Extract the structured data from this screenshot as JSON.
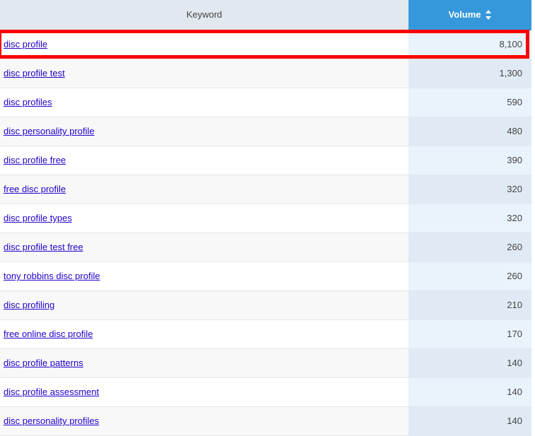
{
  "table": {
    "columns": [
      {
        "key": "keyword",
        "label": "Keyword",
        "align": "center",
        "sortable": false
      },
      {
        "key": "volume",
        "label": "Volume",
        "align": "center",
        "sortable": true,
        "sort_icon": "sort-updown-icon"
      }
    ],
    "header_accent_color": "#3498db",
    "header_keyword_bg": "#e2e8ef",
    "highlight_color": "#fa0000",
    "link_color": "#2200cc",
    "highlighted_row_index": 0,
    "rows": [
      {
        "keyword": "disc profile",
        "volume": "8,100"
      },
      {
        "keyword": "disc profile test",
        "volume": "1,300"
      },
      {
        "keyword": "disc profiles",
        "volume": "590"
      },
      {
        "keyword": "disc personality profile",
        "volume": "480"
      },
      {
        "keyword": "disc profile free",
        "volume": "390"
      },
      {
        "keyword": "free disc profile",
        "volume": "320"
      },
      {
        "keyword": "disc profile types",
        "volume": "320"
      },
      {
        "keyword": "disc profile test free",
        "volume": "260"
      },
      {
        "keyword": "tony robbins disc profile",
        "volume": "260"
      },
      {
        "keyword": "disc profiling",
        "volume": "210"
      },
      {
        "keyword": "free online disc profile",
        "volume": "170"
      },
      {
        "keyword": "disc profile patterns",
        "volume": "140"
      },
      {
        "keyword": "disc profile assessment",
        "volume": "140"
      },
      {
        "keyword": "disc personality profiles",
        "volume": "140"
      }
    ]
  }
}
